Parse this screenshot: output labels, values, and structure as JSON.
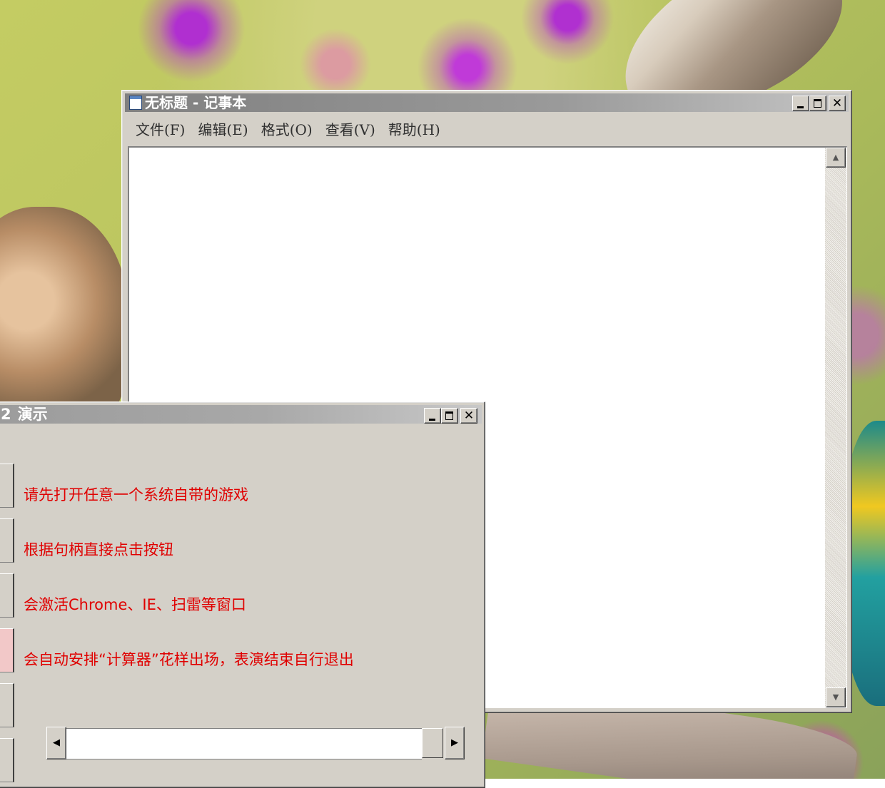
{
  "notepad": {
    "title": "无标题 - 记事本",
    "menu": [
      {
        "label": "文件(F)"
      },
      {
        "label": "编辑(E)"
      },
      {
        "label": "格式(O)"
      },
      {
        "label": "查看(V)"
      },
      {
        "label": "帮助(H)"
      }
    ],
    "content": "",
    "icons": {
      "app": "notepad-icon",
      "scroll_up": "arrow-up-icon",
      "scroll_down": "arrow-down-icon"
    }
  },
  "demo": {
    "title": "演示",
    "title_prefix": "2",
    "labels": [
      "请先打开任意一个系统自带的游戏",
      "根据句柄直接点击按钮",
      "会激活Chrome、IE、扫雷等窗口",
      "会自动安排“计算器”花样出场，表演结束自行退出"
    ],
    "label_color": "#e00000",
    "scrollbar_position": 1.0,
    "icons": {
      "scroll_left": "arrow-left-icon",
      "scroll_right": "arrow-right-icon"
    }
  },
  "glyphs": {
    "min": "_",
    "max": "□",
    "close": "✕",
    "up": "▲",
    "down": "▼",
    "left": "◀",
    "right": "▶"
  }
}
